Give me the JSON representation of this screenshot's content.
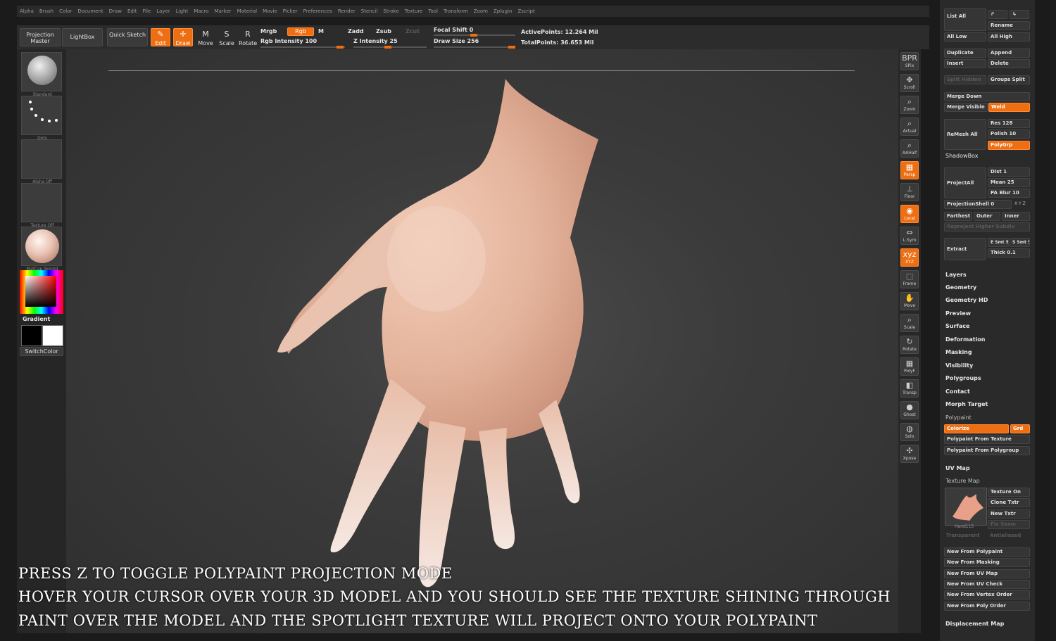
{
  "menu": [
    "Alpha",
    "Brush",
    "Color",
    "Document",
    "Draw",
    "Edit",
    "File",
    "Layer",
    "Light",
    "Macro",
    "Marker",
    "Material",
    "Movie",
    "Picker",
    "Preferences",
    "Render",
    "Stencil",
    "Stroke",
    "Texture",
    "Tool",
    "Transform",
    "Zoom",
    "Zplugin",
    "Zscript"
  ],
  "toolbar": {
    "projection_master": "Projection Master",
    "lightbox": "LightBox",
    "quick_sketch": "Quick Sketch",
    "edit": "Edit",
    "draw": "Draw",
    "move": "Move",
    "scale": "Scale",
    "rotate": "Rotate",
    "mrgb": "Mrgb",
    "rgb": "Rgb",
    "m": "M",
    "rgb_intensity": "Rgb Intensity 100",
    "zadd": "Zadd",
    "zsub": "Zsub",
    "zcut": "Zcut",
    "z_intensity": "Z Intensity 25",
    "focal_shift": "Focal Shift 0",
    "draw_size": "Draw Size 256",
    "active_points": "ActivePoints: 12.264 Mil",
    "total_points": "TotalPoints: 36.653 Mil",
    "rgb_intensity_value": 100,
    "z_intensity_value": 25
  },
  "left_shelf": {
    "brush": "Standard",
    "stroke": "Dots",
    "alpha": "Alpha Off",
    "texture": "Texture Off",
    "material": "MatCap Skin04",
    "gradient": "Gradient",
    "switch_color": "SwitchColor"
  },
  "right_shelf": [
    {
      "icon": "BPR",
      "label": "SPix"
    },
    {
      "icon": "✥",
      "label": "Scroll"
    },
    {
      "icon": "⌕",
      "label": "Zoom"
    },
    {
      "icon": "⌕",
      "label": "Actual"
    },
    {
      "icon": "⌕",
      "label": "AAHalf"
    },
    {
      "icon": "▦",
      "label": "Persp"
    },
    {
      "icon": "⊥",
      "label": "Floor"
    },
    {
      "icon": "◉",
      "label": "Local"
    },
    {
      "icon": "⇔",
      "label": "L.Sym"
    },
    {
      "icon": "xyz",
      "label": "XYZ"
    },
    {
      "icon": "⬚",
      "label": "Frame"
    },
    {
      "icon": "✋",
      "label": "Move"
    },
    {
      "icon": "⌕",
      "label": "Scale"
    },
    {
      "icon": "↻",
      "label": "Rotate"
    },
    {
      "icon": "▦",
      "label": "PolyF"
    },
    {
      "icon": "◧",
      "label": "Transp"
    },
    {
      "icon": "●",
      "label": "Ghost"
    },
    {
      "icon": "◍",
      "label": "Solo"
    },
    {
      "icon": "✣",
      "label": "Xpose"
    }
  ],
  "subtool": {
    "list_all": "List All",
    "rename": "Rename",
    "all_low": "All Low",
    "all_high": "All High",
    "duplicate": "Duplicate",
    "append": "Append",
    "insert": "Insert",
    "delete": "Delete",
    "split_hidden": "Split Hidden",
    "groups_split": "Groups Split",
    "merge_down": "Merge Down",
    "merge_visible": "Merge Visible",
    "weld": "Weld",
    "remesh_all": "ReMesh All",
    "res": "Res 128",
    "polish": "Polish 10",
    "polygrp": "PolyGrp",
    "shadowbox": "ShadowBox",
    "project_all": "ProjectAll",
    "dist": "Dist 1",
    "mean": "Mean 25",
    "pa_blur": "PA Blur 10",
    "projection_shell": "ProjectionShell 0",
    "xyz": "X Y Z",
    "farthest": "Farthest",
    "outer": "Outer",
    "inner": "Inner",
    "reproject": "Reproject Higher Subdiv",
    "extract": "Extract",
    "e_smt": "E Smt 5",
    "s_smt": "S Smt 5",
    "thick": "Thick 0.1"
  },
  "sections": [
    "Layers",
    "Geometry",
    "Geometry HD",
    "Preview",
    "Surface",
    "Deformation",
    "Masking",
    "Visibility",
    "Polygroups",
    "Contact",
    "Morph Target"
  ],
  "polypaint": {
    "title": "Polypaint",
    "colorize": "Colorize",
    "grd": "Grd",
    "from_texture": "Polypaint From Texture",
    "from_polygroup": "Polypaint From Polygroup"
  },
  "uv_map": "UV Map",
  "texture_map": {
    "title": "Texture Map",
    "texture_on": "Texture On",
    "clone_txtr": "Clone Txtr",
    "new_txtr": "New Txtr",
    "fix_seam": "Fix Seam",
    "thumb_label": "Hand115",
    "transparent": "Transparent",
    "antialiased": "Antialiased",
    "new_from": [
      "New From Polypaint",
      "New From Masking",
      "New From UV Map",
      "New From UV Check",
      "New From Vertex Order",
      "New From Poly Order"
    ]
  },
  "displacement_map": "Displacement Map",
  "overlay": [
    "PRESS Z TO TOGGLE POLYPAINT PROJECTION MODE",
    "HOVER YOUR CURSOR OVER YOUR 3D MODEL AND YOU SHOULD SEE THE TEXTURE SHINING THROUGH",
    "PAINT OVER THE MODEL AND THE SPOTLIGHT TEXTURE WILL PROJECT ONTO YOUR POLYPAINT"
  ],
  "colors": {
    "accent": "#ee6e12",
    "panel": "#2a2a2a",
    "canvas": "#3b3b3b",
    "skin": "#e6b49a"
  }
}
